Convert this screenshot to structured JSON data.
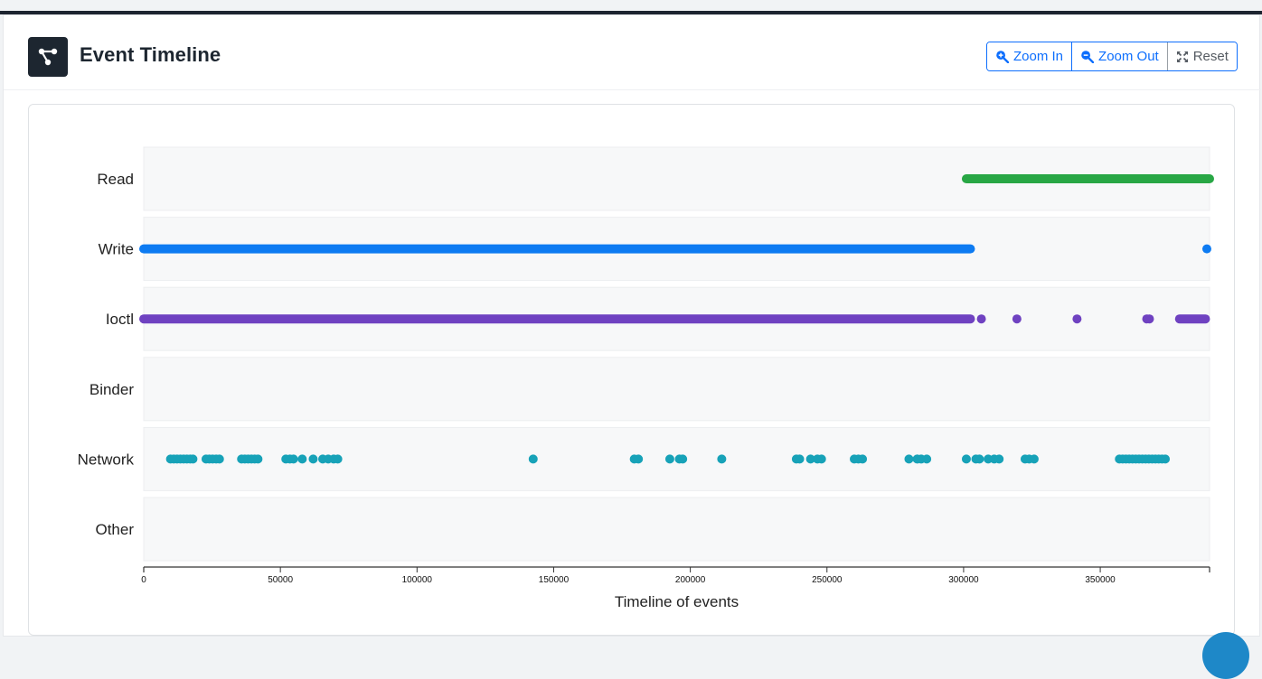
{
  "header": {
    "title": "Event Timeline",
    "logo_icon": "share-nodes-icon",
    "buttons": {
      "zoom_in": "Zoom In",
      "zoom_out": "Zoom Out",
      "reset": "Reset"
    }
  },
  "chart_data": {
    "type": "scatter",
    "xlabel": "Timeline of events",
    "xlim": [
      0,
      390000
    ],
    "x_ticks": [
      0,
      50000,
      100000,
      150000,
      200000,
      250000,
      300000,
      350000
    ],
    "categories": [
      "Read",
      "Write",
      "Ioctl",
      "Binder",
      "Network",
      "Other"
    ],
    "series": [
      {
        "category": "Read",
        "color": "#28a745",
        "ranges": [
          [
            301000,
            390000
          ]
        ],
        "points": []
      },
      {
        "category": "Write",
        "color": "#0d7bf2",
        "ranges": [
          [
            0,
            302500
          ]
        ],
        "points": [
          389000
        ]
      },
      {
        "category": "Ioctl",
        "color": "#6f42c1",
        "ranges": [
          [
            0,
            302500
          ],
          [
            379000,
            388500
          ]
        ],
        "points": [
          306500,
          319500,
          341500,
          367000,
          368000
        ]
      },
      {
        "category": "Binder",
        "color": "#17a2b8",
        "ranges": [],
        "points": []
      },
      {
        "category": "Network",
        "color": "#17a2b8",
        "ranges": [],
        "points": [
          9800,
          11000,
          12200,
          13400,
          14600,
          15800,
          17000,
          18000,
          22800,
          24000,
          25200,
          26500,
          27700,
          35800,
          37000,
          38200,
          39400,
          40600,
          41800,
          52000,
          53500,
          54800,
          58000,
          62000,
          65500,
          67500,
          69500,
          71000,
          142500,
          179500,
          181000,
          192500,
          196000,
          197200,
          211500,
          238800,
          240000,
          244000,
          246500,
          248000,
          260000,
          261500,
          263000,
          280000,
          283000,
          284500,
          286500,
          301000,
          304500,
          305800,
          309000,
          311200,
          313000,
          322500,
          324000,
          325800,
          357000,
          358200,
          359400,
          360600,
          361800,
          363000,
          364200,
          365400,
          366600,
          367800,
          369000,
          370200,
          371400,
          372600,
          373800
        ]
      },
      {
        "category": "Other",
        "color": "#17a2b8",
        "ranges": [],
        "points": []
      }
    ]
  }
}
